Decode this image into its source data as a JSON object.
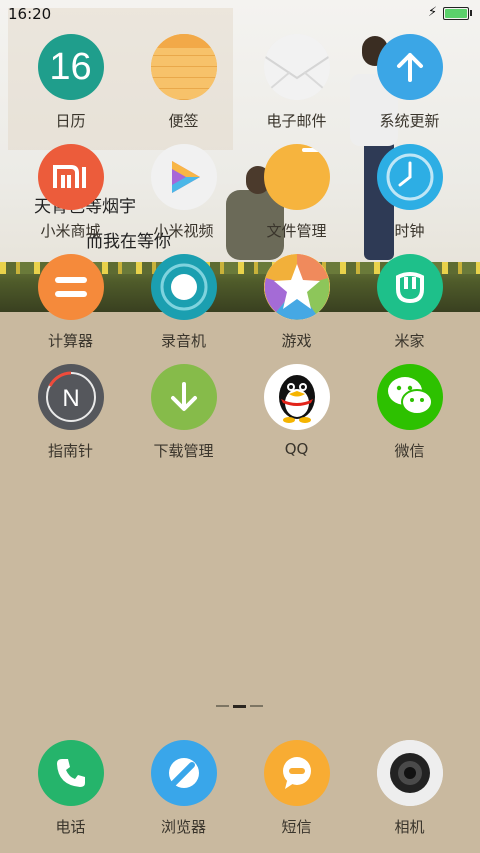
{
  "status_bar": {
    "time": "16:20",
    "battery_percent": 100,
    "charging": true,
    "battery_color": "#5bd16b"
  },
  "wallpaper": {
    "poem_line1": "天青色等烟宇",
    "poem_line2": "而我在等你"
  },
  "apps": [
    {
      "name": "calendar-app",
      "label": "日历",
      "icon": "calendar-icon",
      "text": "16",
      "color": "#1f9e8c"
    },
    {
      "name": "notes-app",
      "label": "便签",
      "icon": "notes-icon",
      "color": "#f5b64e"
    },
    {
      "name": "email-app",
      "label": "电子邮件",
      "icon": "envelope-icon",
      "color": "#eeeeee"
    },
    {
      "name": "system-update-app",
      "label": "系统更新",
      "icon": "arrow-up-icon",
      "color": "#3ba6e6"
    },
    {
      "name": "mi-store-app",
      "label": "小米商城",
      "icon": "mi-logo-icon",
      "text": "mi",
      "color": "#ec5c3b"
    },
    {
      "name": "video-app",
      "label": "小米视频",
      "icon": "play-icon",
      "color": "#f1f1f1"
    },
    {
      "name": "file-manager-app",
      "label": "文件管理",
      "icon": "folder-icon",
      "color": "#f6b43e"
    },
    {
      "name": "clock-app",
      "label": "时钟",
      "icon": "clock-icon",
      "color": "#2daee4"
    },
    {
      "name": "calculator-app",
      "label": "计算器",
      "icon": "equals-icon",
      "color": "#f58a3b"
    },
    {
      "name": "recorder-app",
      "label": "录音机",
      "icon": "record-icon",
      "color": "#1b9fb0"
    },
    {
      "name": "game-app",
      "label": "游戏",
      "icon": "star-icon",
      "color": "#ffffff"
    },
    {
      "name": "mi-home-app",
      "label": "米家",
      "icon": "mi-home-icon",
      "color": "#1ec08a"
    },
    {
      "name": "compass-app",
      "label": "指南针",
      "icon": "compass-icon",
      "text": "N",
      "color": "#55575c"
    },
    {
      "name": "download-manager-app",
      "label": "下载管理",
      "icon": "download-icon",
      "color": "#86bb4a"
    },
    {
      "name": "qq-app",
      "label": "QQ",
      "icon": "penguin-icon",
      "color": "#ffffff"
    },
    {
      "name": "wechat-app",
      "label": "微信",
      "icon": "wechat-icon",
      "color": "#2dc100"
    }
  ],
  "dock": [
    {
      "name": "phone-app",
      "label": "电话",
      "icon": "phone-icon",
      "color": "#25b46b"
    },
    {
      "name": "browser-app",
      "label": "浏览器",
      "icon": "browser-icon",
      "color": "#39a6ea"
    },
    {
      "name": "messages-app",
      "label": "短信",
      "icon": "message-icon",
      "color": "#f8ac33"
    },
    {
      "name": "camera-app",
      "label": "相机",
      "icon": "camera-icon",
      "color": "#eeeeee"
    }
  ],
  "pager": {
    "pages": 3,
    "current": 2
  }
}
